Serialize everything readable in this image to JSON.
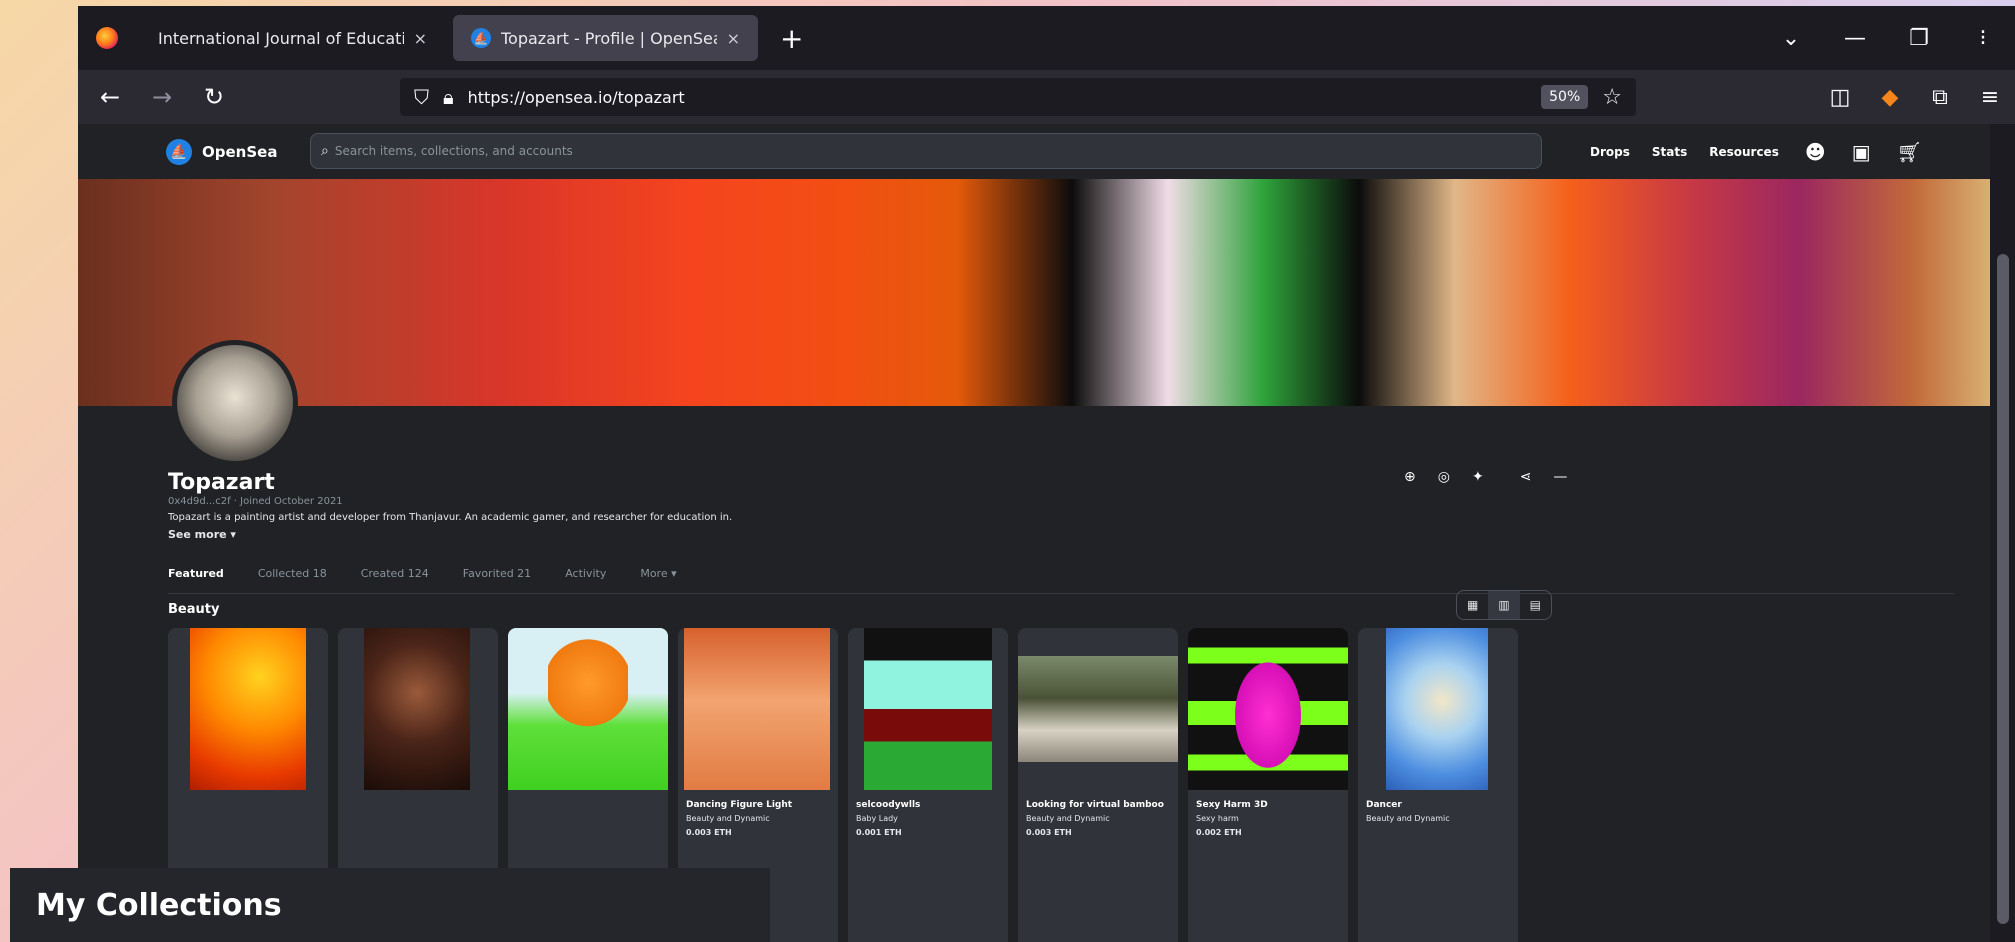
{
  "browser": {
    "tabs": [
      {
        "title": "International Journal of Educational",
        "close": "×"
      },
      {
        "title": "Topazart - Profile | OpenSea",
        "close": "×"
      }
    ],
    "new_tab": "+",
    "window_controls": {
      "list": "⌄",
      "minimize": "—",
      "restore": "❐",
      "close": "⁝"
    },
    "url": "https://opensea.io/topazart",
    "zoom": "50%"
  },
  "opensea": {
    "brand": "OpenSea",
    "search_placeholder": "Search items, collections, and accounts",
    "nav": [
      "Drops",
      "Stats",
      "Resources"
    ],
    "profile": {
      "name": "Topazart",
      "meta": "0x4d9d...c2f · Joined October 2021",
      "bio": "Topazart is a painting artist and developer from Thanjavur. An academic gamer, and researcher for education in.",
      "see_more": "See more ▾"
    },
    "tabs": [
      "Featured",
      "Collected 18",
      "Created 124",
      "Favorited 21",
      "Activity",
      "More ▾"
    ],
    "section_title": "Beauty",
    "cards": [
      {
        "name": "",
        "collection": "",
        "price": ""
      },
      {
        "name": "",
        "collection": "",
        "price": ""
      },
      {
        "name": "",
        "collection": "",
        "price": ""
      },
      {
        "name": "Dancing Figure Light",
        "collection": "Beauty and Dynamic",
        "price": "0.003 ETH"
      },
      {
        "name": "selcoodywlls",
        "collection": "Baby Lady",
        "price": "0.001 ETH"
      },
      {
        "name": "Looking for virtual bamboo",
        "collection": "Beauty and Dynamic",
        "price": "0.003 ETH"
      },
      {
        "name": "Sexy Harm 3D",
        "collection": "Sexy harm",
        "price": "0.002 ETH"
      },
      {
        "name": "Dancer",
        "collection": "Beauty and Dynamic",
        "price": ""
      }
    ]
  },
  "overlay": {
    "title": "My Collections"
  }
}
